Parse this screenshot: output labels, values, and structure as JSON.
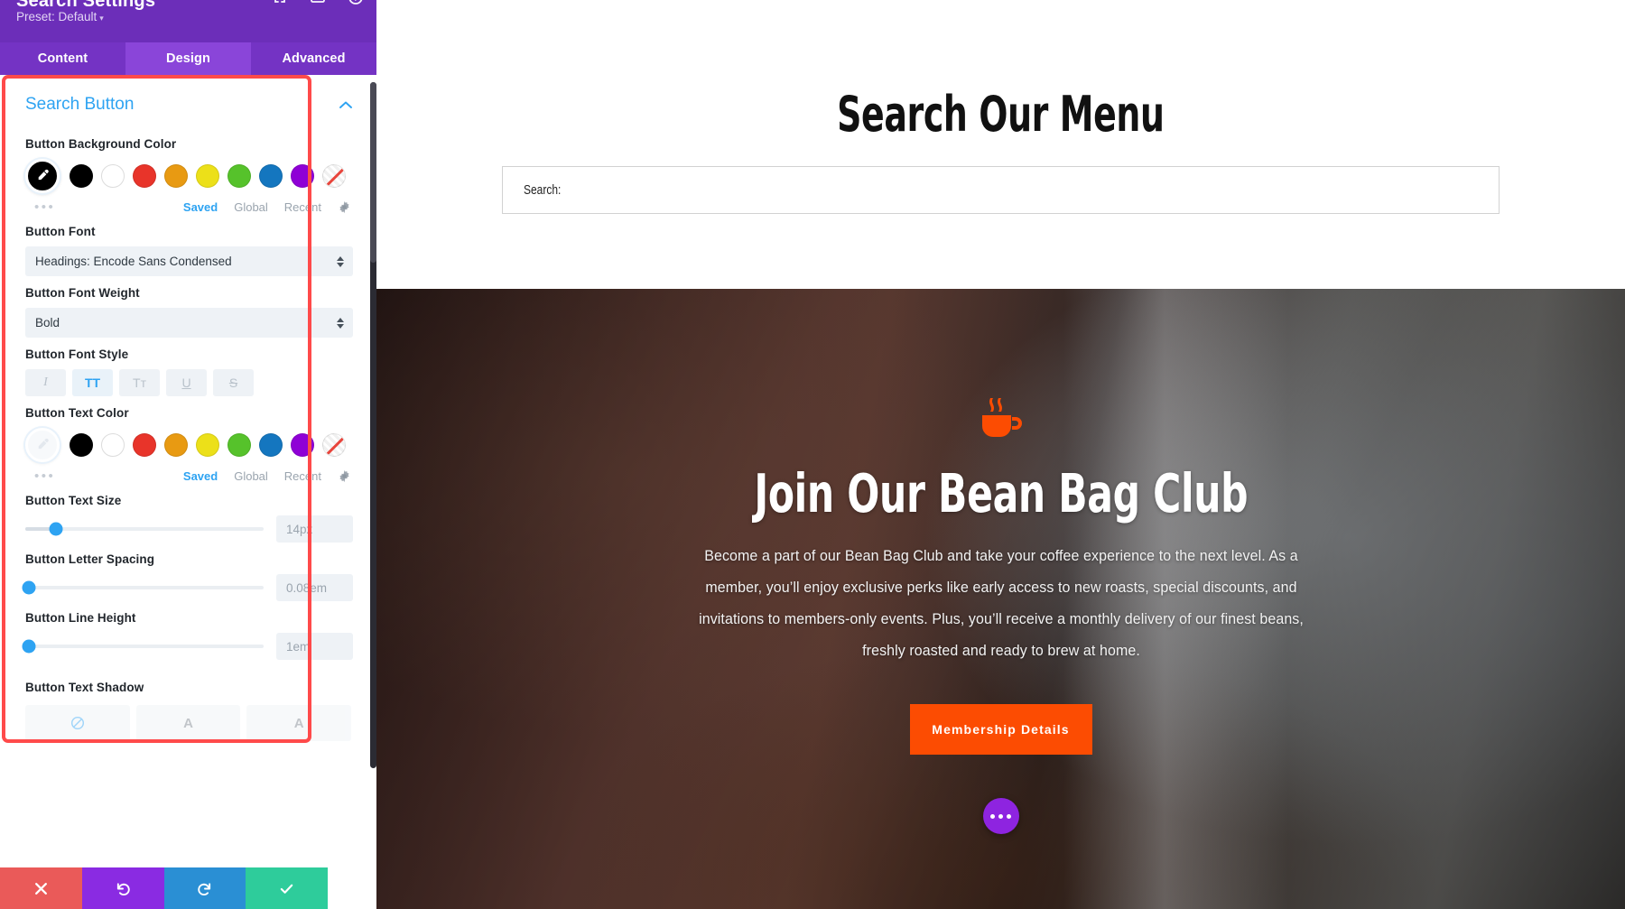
{
  "panel": {
    "title": "Search Settings",
    "preset_label": "Preset: Default",
    "preset_caret": "▾",
    "icons": [
      "arrows-expand-icon",
      "layout-icon",
      "help-icon"
    ],
    "tabs": [
      {
        "label": "Content",
        "active": false
      },
      {
        "label": "Design",
        "active": true
      },
      {
        "label": "Advanced",
        "active": false
      }
    ],
    "group": {
      "title": "Search Button",
      "collapse_caret": "⌃"
    },
    "palette_links": [
      {
        "label": "Saved",
        "active": true
      },
      {
        "label": "Global",
        "active": false
      },
      {
        "label": "Recent",
        "active": false
      }
    ],
    "swatch_colors": [
      "#000000",
      "#ffffff",
      "#e8342a",
      "#e89a12",
      "#ece019",
      "#56c22b",
      "#1476bf",
      "#8f00d6"
    ],
    "more_dots": "•••",
    "fields": {
      "bg_color_label": "Button Background Color",
      "font_label": "Button Font",
      "font_value": "Headings: Encode Sans Condensed",
      "font_weight_label": "Button Font Weight",
      "font_weight_value": "Bold",
      "font_style_label": "Button Font Style",
      "font_style_buttons": [
        {
          "glyph": "I",
          "name": "italic",
          "on": false
        },
        {
          "glyph": "TT",
          "name": "uppercase",
          "on": true
        },
        {
          "glyph": "Tᴛ",
          "name": "small-caps",
          "on": false
        },
        {
          "glyph": "U",
          "name": "underline",
          "on": false
        },
        {
          "glyph": "S",
          "name": "strikethrough",
          "on": false
        }
      ],
      "text_color_label": "Button Text Color",
      "text_size_label": "Button Text Size",
      "text_size_value": "14px",
      "letter_spacing_label": "Button Letter Spacing",
      "letter_spacing_value": "0.08em",
      "line_height_label": "Button Line Height",
      "line_height_value": "1em",
      "text_shadow_label": "Button Text Shadow"
    },
    "actions": [
      {
        "name": "cancel",
        "color": "#ea5a59"
      },
      {
        "name": "undo",
        "color": "#8a2be2"
      },
      {
        "name": "redo",
        "color": "#2a8fd4"
      },
      {
        "name": "save",
        "color": "#2ecc9b"
      }
    ]
  },
  "preview": {
    "search_section": {
      "heading": "Search Our Menu",
      "input_placeholder": "Search:",
      "input_value": ""
    },
    "hero": {
      "icon": "coffee-cup-icon",
      "icon_color": "#fc4c02",
      "heading": "Join Our Bean Bag Club",
      "paragraph": "Become a part of our Bean Bag Club and take your coffee experience to the next level. As a member, you’ll enjoy exclusive perks like early access to new roasts, special discounts, and invitations to members-only events. Plus, you’ll receive a monthly delivery of our finest beans, freshly roasted and ready to brew at home.",
      "button_label": "Membership Details",
      "button_color": "#fc4c02",
      "fab": {
        "name": "more-options-fab",
        "color": "#8e24e0"
      }
    }
  },
  "colors": {
    "panel_header": "#6c2eb9",
    "tab_active": "#8a45d9",
    "accent_blue": "#2ea3f2",
    "highlight_box": "#ff4a4a"
  }
}
